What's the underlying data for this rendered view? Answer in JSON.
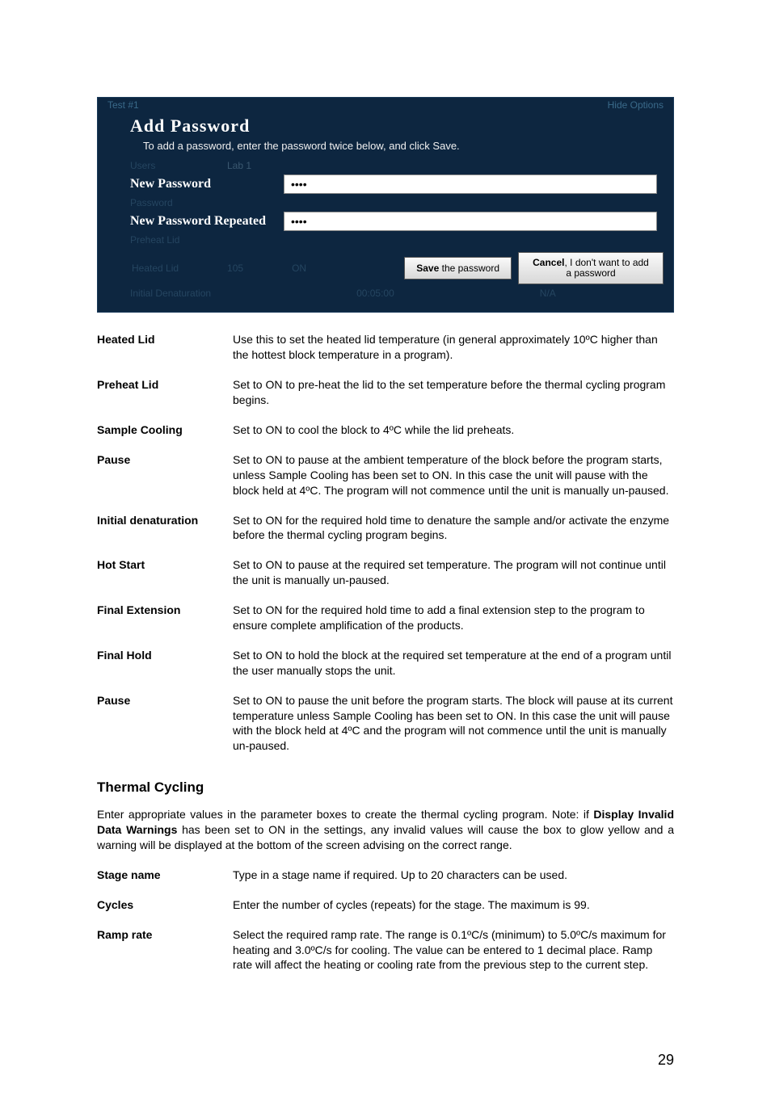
{
  "dialog": {
    "ghost_top_left": "Test #1",
    "ghost_top_right": "Hide Options",
    "title": "Add Password",
    "subtitle": "To add a password, enter the password twice below, and click Save.",
    "ghost_users": "Users",
    "ghost_lab": "Lab 1",
    "new_password_label": "New Password",
    "new_password_value": "••••",
    "ghost_password": "Password",
    "new_password_repeated_label": "New Password Repeated",
    "new_password_repeated_value": "••••",
    "ghost_preheat": "Preheat Lid",
    "ghost_heated": "Heated Lid",
    "ghost_105": "105",
    "ghost_on": "ON",
    "save_strong": "Save",
    "save_rest": " the password",
    "cancel_strong": "Cancel",
    "cancel_rest": ", I don't want to add a password",
    "ghost_initial": "Initial Denaturation",
    "ghost_time": "00:05:00",
    "ghost_na": "N/A"
  },
  "defs1": [
    {
      "term": "Heated Lid",
      "desc": "Use this to set the heated lid temperature (in general approximately 10ºC higher than the hottest block temperature in a program)."
    },
    {
      "term": "Preheat Lid",
      "desc": "Set to ON to pre-heat the lid to the set temperature before the thermal cycling program begins."
    },
    {
      "term": "Sample Cooling",
      "desc": "Set to ON to cool the block to 4ºC while the lid preheats."
    },
    {
      "term": "Pause",
      "desc": "Set to ON to pause at the ambient temperature of the block before the program starts, unless Sample Cooling has been set to ON. In this case the unit will pause with the block held at 4ºC. The program will not commence until the unit is manually un-paused."
    },
    {
      "term": "Initial denaturation",
      "desc": "Set to ON for the required hold time to denature the sample and/or activate the enzyme before the thermal cycling program begins."
    },
    {
      "term": "Hot Start",
      "desc": "Set to ON to pause at the required set temperature. The program will not continue until the unit is manually un-paused."
    },
    {
      "term": "Final Extension",
      "desc": "Set to ON for the required hold time to add a final extension step to the program to ensure complete amplification of the products."
    },
    {
      "term": "Final Hold",
      "desc": "Set to ON to hold the block at the required set temperature at the end of a program until the user manually stops the unit."
    },
    {
      "term": "Pause",
      "desc": "Set to ON to pause the unit before the program starts. The block will pause at its current temperature unless Sample Cooling has been set to ON. In this case the unit will pause with the block held at 4ºC and the program will not commence until the unit is manually un-paused."
    }
  ],
  "section_title": "Thermal Cycling",
  "body_pre": "Enter appropriate values in the parameter boxes to create the thermal cycling program. Note: if ",
  "body_bold": "Display Invalid Data Warnings",
  "body_post": " has been set to ON in the settings, any invalid values will cause the box to glow yellow and a warning will be displayed at the bottom of the screen advising on the correct range.",
  "defs2": [
    {
      "term": "Stage name",
      "desc": "Type in a stage name if required. Up to 20 characters can be used."
    },
    {
      "term": "Cycles",
      "desc": "Enter the number of cycles (repeats) for the stage. The maximum is 99."
    },
    {
      "term": "Ramp rate",
      "desc": "Select the required ramp rate. The range is 0.1ºC/s (minimum) to 5.0ºC/s maximum for heating and 3.0ºC/s for cooling. The value can be entered to 1 decimal place. Ramp rate will affect the heating or cooling rate from the previous step to the current step."
    }
  ],
  "page_number": "29"
}
